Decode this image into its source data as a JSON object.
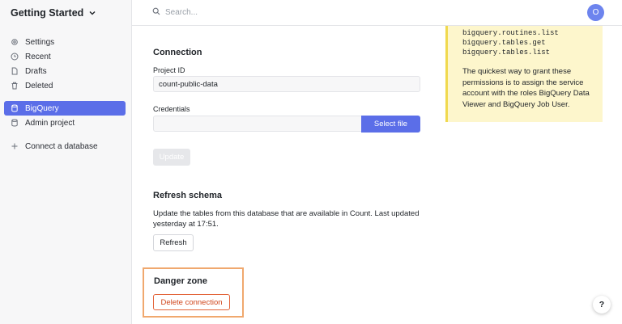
{
  "workspace": {
    "name": "Getting Started",
    "chevron_icon": "chevron-down-icon"
  },
  "sidebar": {
    "primary": [
      {
        "label": "Settings",
        "icon": "gear-icon"
      },
      {
        "label": "Recent",
        "icon": "clock-icon"
      },
      {
        "label": "Drafts",
        "icon": "document-icon"
      },
      {
        "label": "Deleted",
        "icon": "trash-icon"
      }
    ],
    "connections": [
      {
        "label": "BigQuery",
        "icon": "database-icon",
        "active": true
      },
      {
        "label": "Admin project",
        "icon": "database-icon",
        "active": false
      }
    ],
    "add_connection": {
      "label": "Connect a database",
      "icon": "plus-icon"
    }
  },
  "topbar": {
    "search_placeholder": "Search...",
    "avatar_initial": "O"
  },
  "connection": {
    "title": "Connection",
    "project_id_label": "Project ID",
    "project_id_value": "count-public-data",
    "credentials_label": "Credentials",
    "credentials_value": "",
    "select_file_label": "Select file",
    "update_label": "Update"
  },
  "refresh": {
    "title": "Refresh schema",
    "description": "Update the tables from this database that are available in Count. Last updated yesterday at 17:51.",
    "button_label": "Refresh"
  },
  "danger": {
    "title": "Danger zone",
    "button_label": "Delete connection"
  },
  "note": {
    "code_lines": [
      "bigquery.routines.list",
      "bigquery.tables.get",
      "bigquery.tables.list"
    ],
    "text": "The quickest way to grant these permissions is to assign the service account with the roles BigQuery Data Viewer and BigQuery Job User."
  },
  "help": {
    "label": "?"
  },
  "colors": {
    "accent": "#5b6ee8",
    "danger": "#d0451b",
    "note_bg": "#fdf6cc",
    "highlight": "#f0a86e"
  }
}
